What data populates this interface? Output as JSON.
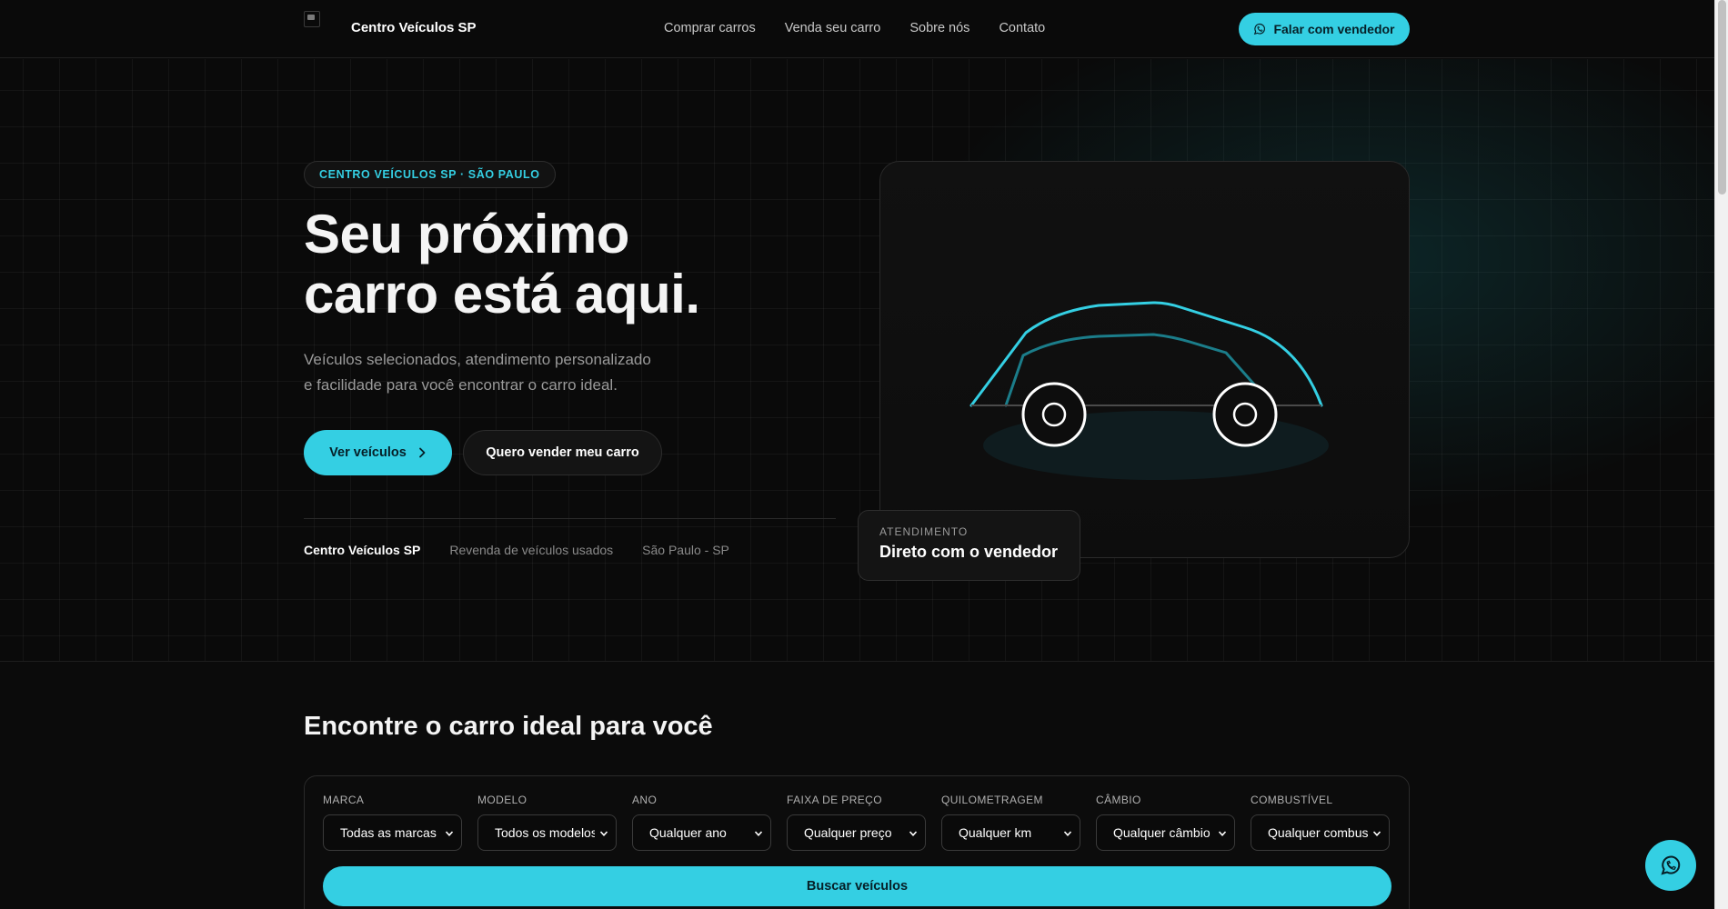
{
  "header": {
    "logo_alt": "",
    "brand": "Centro Veículos SP",
    "nav": [
      "Comprar carros",
      "Venda seu carro",
      "Sobre nós",
      "Contato"
    ],
    "cta_label": "Falar com vendedor",
    "cta_icon": "whatsapp-icon"
  },
  "hero": {
    "badge": "CENTRO VEÍCULOS SP · SÃO PAULO",
    "title_lines": [
      "Seu próximo",
      "carro está aqui."
    ],
    "subtitle_lines": [
      "Veículos selecionados, atendimento personalizado",
      "e facilidade para você encontrar o carro ideal."
    ],
    "primary_button": "Ver veículos",
    "primary_button_icon": "chevron-right-icon",
    "secondary_button": "Quero vender meu carro",
    "info": [
      "Centro Veículos SP",
      "Revenda de veículos usados",
      "São Paulo - SP"
    ],
    "card": {
      "illustration": "car-outline-illustration",
      "label": "ATENDIMENTO",
      "value": "Direto com o vendedor"
    }
  },
  "search": {
    "title": "Encontre o carro ideal para você",
    "filters": [
      {
        "label": "MARCA",
        "value": "Todas as marcas"
      },
      {
        "label": "MODELO",
        "value": "Todos os modelos"
      },
      {
        "label": "ANO",
        "value": "Qualquer ano"
      },
      {
        "label": "FAIXA DE PREÇO",
        "value": "Qualquer preço"
      },
      {
        "label": "QUILOMETRAGEM",
        "value": "Qualquer km"
      },
      {
        "label": "CÂMBIO",
        "value": "Qualquer câmbio"
      },
      {
        "label": "COMBUSTÍVEL",
        "value": "Qualquer combustível"
      }
    ],
    "button": "Buscar veículos"
  },
  "fab_icon": "whatsapp-icon",
  "colors": {
    "accent": "#34cfe3",
    "background": "#0a0a0a",
    "text": "#ffffff",
    "muted": "#9a9a9a"
  }
}
